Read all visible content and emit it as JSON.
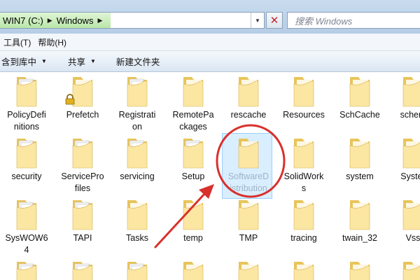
{
  "address_bar": {
    "crumbs": [
      "WIN7 (C:)",
      "Windows"
    ]
  },
  "search": {
    "placeholder": "搜索 Windows"
  },
  "menu": {
    "items": [
      "工具(T)",
      "帮助(H)"
    ]
  },
  "toolbar": {
    "include_in_library": "含到库中",
    "share": "共享",
    "new_folder": "新建文件夹"
  },
  "files": {
    "row1": [
      "PolicyDefinitions",
      "Prefetch",
      "Registration",
      "RemotePackages",
      "rescache",
      "Resources",
      "SchCache",
      "schemas"
    ],
    "row1_display": [
      "PolicyDefi\nnitions",
      "Prefetch",
      "Registrati\non",
      "RemotePa\nckages",
      "rescache",
      "Resources",
      "SchCache",
      "schem"
    ],
    "row2_display": [
      "security",
      "ServicePro\nfiles",
      "servicing",
      "Setup",
      "SoftwareD\nistribution",
      "SolidWork\ns",
      "system",
      "Syster"
    ],
    "row3_display": [
      "SysWOW6\n4",
      "TAPI",
      "Tasks",
      "temp",
      "TMP",
      "tracing",
      "twain_32",
      "Vss"
    ]
  },
  "selected_item": "SoftwareDistribution",
  "colors": {
    "folder_light": "#fbe6a2",
    "folder_dark": "#e8c45a",
    "annotation_red": "#d9302c",
    "selection": "#cce8ff"
  }
}
